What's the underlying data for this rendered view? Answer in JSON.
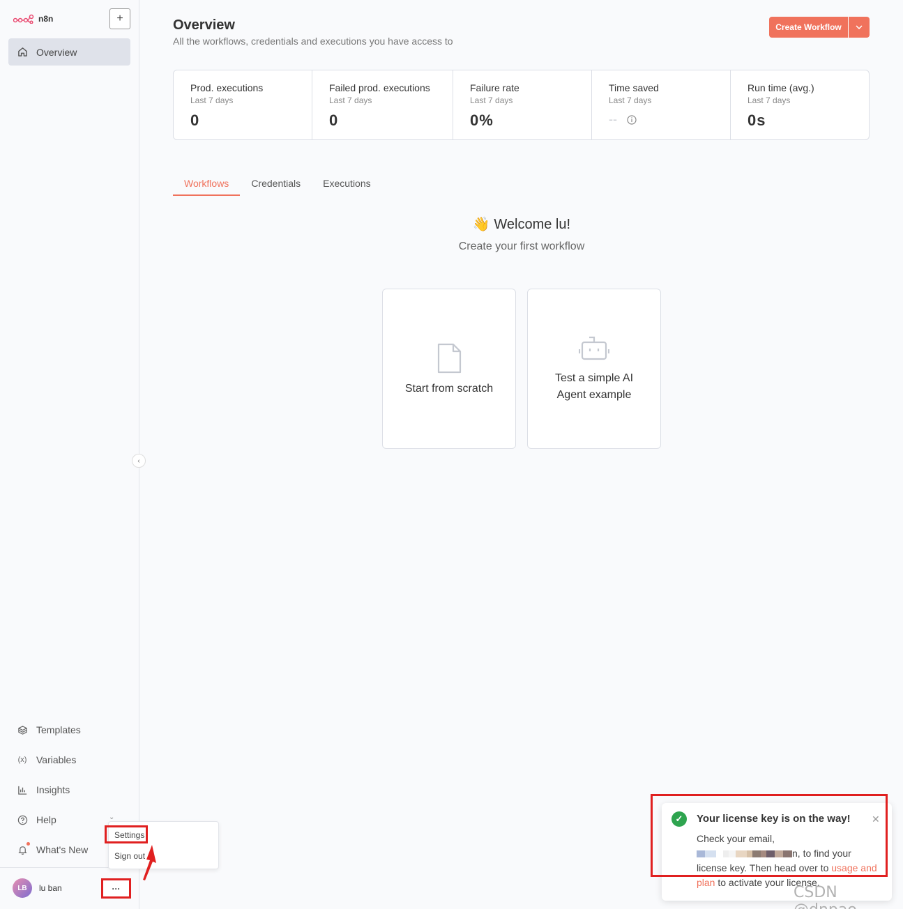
{
  "app": {
    "logo_text": "n8n"
  },
  "sidebar": {
    "overview_label": "Overview",
    "bottom_items": [
      {
        "label": "Templates",
        "icon": "box-icon"
      },
      {
        "label": "Variables",
        "icon": "variable-icon"
      },
      {
        "label": "Insights",
        "icon": "chart-icon"
      },
      {
        "label": "Help",
        "icon": "help-icon"
      },
      {
        "label": "What's New",
        "icon": "bell-icon"
      }
    ],
    "user": {
      "initials": "LB",
      "name": "lu ban"
    },
    "more_label": "···"
  },
  "popup_menu": {
    "settings": "Settings",
    "sign_out": "Sign out"
  },
  "header": {
    "title": "Overview",
    "subtitle": "All the workflows, credentials and executions you have access to",
    "create_button": "Create Workflow"
  },
  "stats": [
    {
      "title": "Prod. executions",
      "period": "Last 7 days",
      "value": "0"
    },
    {
      "title": "Failed prod. executions",
      "period": "Last 7 days",
      "value": "0"
    },
    {
      "title": "Failure rate",
      "period": "Last 7 days",
      "value": "0%"
    },
    {
      "title": "Time saved",
      "period": "Last 7 days",
      "value": "--"
    },
    {
      "title": "Run time (avg.)",
      "period": "Last 7 days",
      "value": "0s"
    }
  ],
  "tabs": [
    "Workflows",
    "Credentials",
    "Executions"
  ],
  "welcome": {
    "emoji": "👋",
    "title": "Welcome lu!",
    "subtitle": "Create your first workflow"
  },
  "cards": [
    {
      "label": "Start from scratch"
    },
    {
      "label": "Test a simple AI Agent example"
    }
  ],
  "toast": {
    "title": "Your license key is on the way!",
    "line1": "Check your email,",
    "line2_suffix": "n, to find your",
    "line3": "license key. Then head over to ",
    "link": "usage and plan",
    "line4": " to activate your license."
  },
  "watermark": "CSDN @dnpao",
  "colors": {
    "accent": "#f0725c",
    "success": "#2ea44f",
    "highlight": "#e02020"
  }
}
